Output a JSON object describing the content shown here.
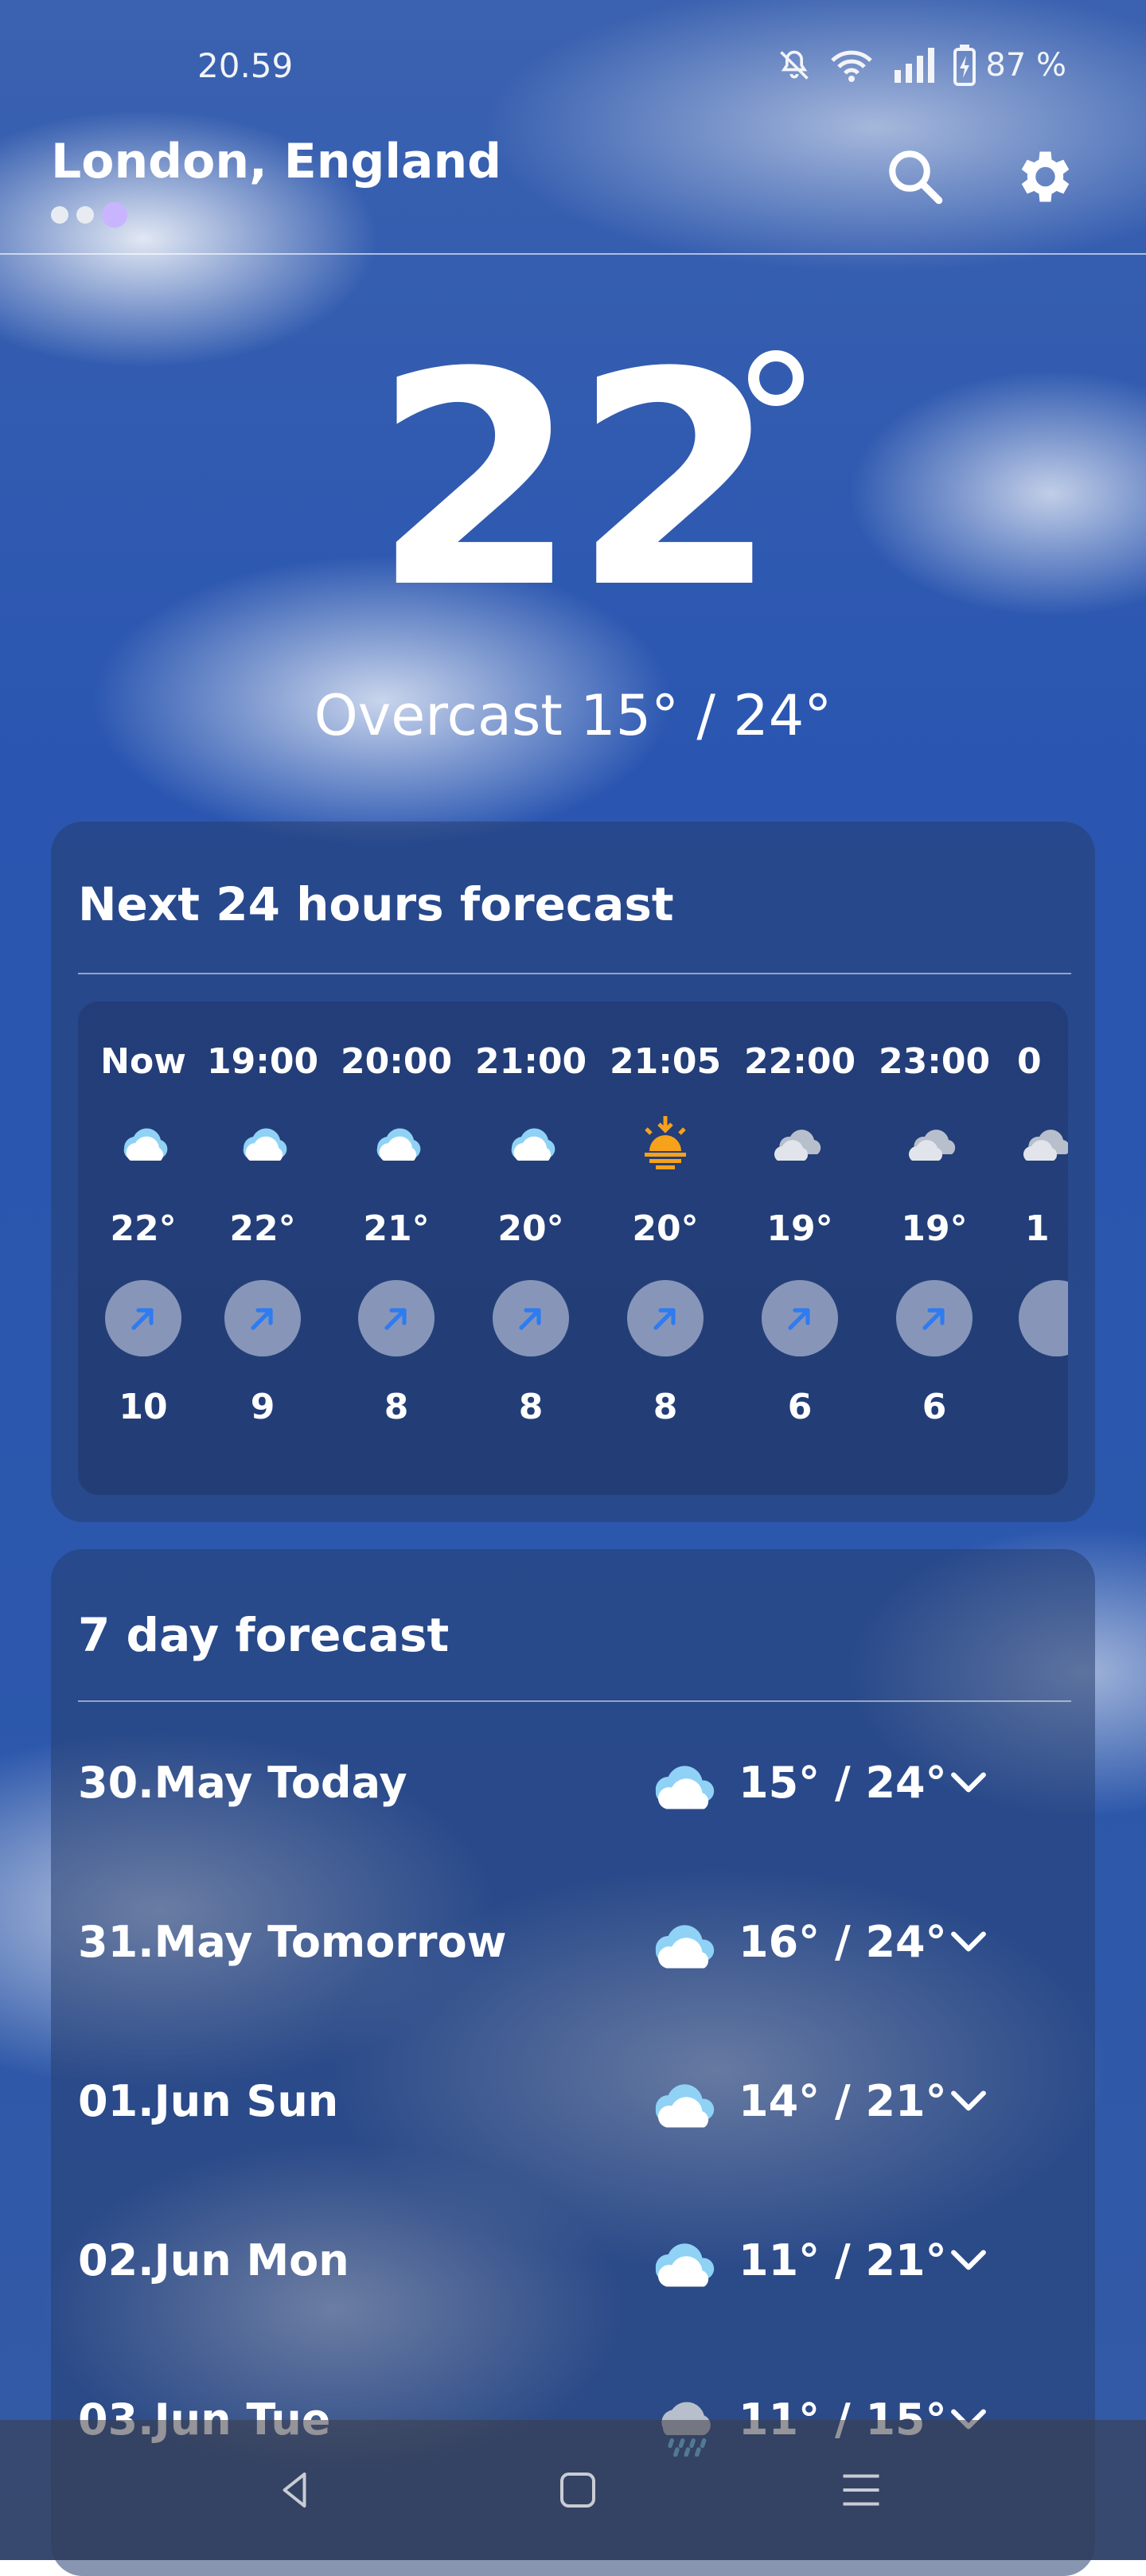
{
  "status_bar": {
    "time": "20.59",
    "battery": "87 %",
    "icons": [
      "mute-icon",
      "wifi-icon",
      "signal-icon",
      "battery-icon"
    ]
  },
  "header": {
    "location": "London, England",
    "page_dots": 3,
    "active_dot_index": 2,
    "icons": [
      "search-icon",
      "gear-icon"
    ]
  },
  "current": {
    "temperature": "22",
    "condition_range": "Overcast 15° / 24°"
  },
  "hourly": {
    "title": "Next 24 hours forecast",
    "items": [
      {
        "time": "Now",
        "icon": "partly-cloudy-icon",
        "temp": "22°",
        "wind": "10"
      },
      {
        "time": "19:00",
        "icon": "partly-cloudy-icon",
        "temp": "22°",
        "wind": "9"
      },
      {
        "time": "20:00",
        "icon": "partly-cloudy-icon",
        "temp": "21°",
        "wind": "8"
      },
      {
        "time": "21:00",
        "icon": "partly-cloudy-icon",
        "temp": "20°",
        "wind": "8"
      },
      {
        "time": "21:05",
        "icon": "sunset-icon",
        "temp": "20°",
        "wind": "8"
      },
      {
        "time": "22:00",
        "icon": "cloudy-icon",
        "temp": "19°",
        "wind": "6"
      },
      {
        "time": "23:00",
        "icon": "cloudy-icon",
        "temp": "19°",
        "wind": "6"
      },
      {
        "time": "0",
        "icon": "cloudy-icon",
        "temp": "1",
        "wind": ""
      }
    ]
  },
  "daily": {
    "title": "7 day forecast",
    "items": [
      {
        "label": "30.May Today",
        "icon": "partly-cloudy-icon",
        "temps": "15° / 24°"
      },
      {
        "label": "31.May Tomorrow",
        "icon": "partly-cloudy-icon",
        "temps": "16° / 24°"
      },
      {
        "label": "01.Jun Sun",
        "icon": "partly-cloudy-icon",
        "temps": "14° / 21°"
      },
      {
        "label": "02.Jun Mon",
        "icon": "partly-cloudy-icon",
        "temps": "11° / 21°"
      },
      {
        "label": "03.Jun Tue",
        "icon": "rain-icon",
        "temps": "11° / 15°"
      }
    ]
  },
  "nav_bar": {
    "icons": [
      "back-icon",
      "home-icon",
      "recents-icon"
    ]
  },
  "colors": {
    "sky": "#2a56b1",
    "card": "#263e70",
    "wind_arrow": "#2f7bf0",
    "sun": "#f7a21b",
    "active_dot": "#c9b5ff"
  }
}
